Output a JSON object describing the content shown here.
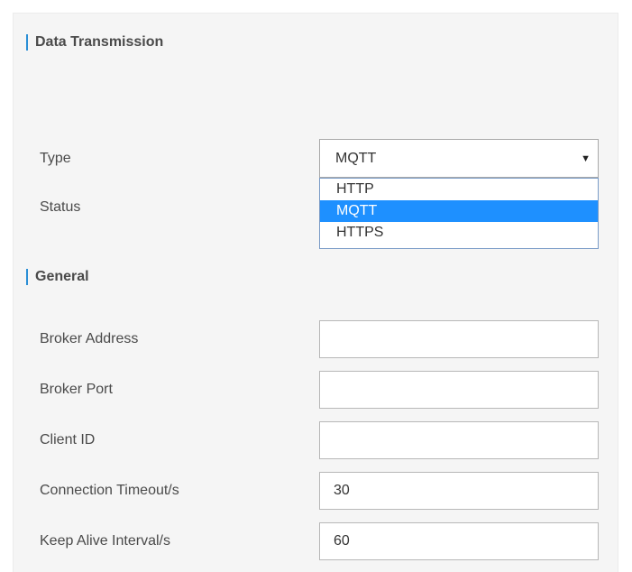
{
  "sections": {
    "data_transmission": "Data Transmission",
    "general": "General"
  },
  "type_field": {
    "label": "Type",
    "selected": "MQTT",
    "arrow_icon": "triangle-down-icon",
    "options": [
      "HTTP",
      "MQTT",
      "HTTPS"
    ],
    "highlighted_index": 1
  },
  "status_field": {
    "label": "Status"
  },
  "fields": {
    "broker_address": {
      "label": "Broker Address",
      "value": ""
    },
    "broker_port": {
      "label": "Broker Port",
      "value": ""
    },
    "client_id": {
      "label": "Client ID",
      "value": ""
    },
    "connection_timeout": {
      "label": "Connection Timeout/s",
      "value": "30"
    },
    "keep_alive_interval": {
      "label": "Keep Alive Interval/s",
      "value": "60"
    }
  },
  "colors": {
    "accent": "#2b8fd6",
    "selected_option": "#1e90ff",
    "panel_background": "#f5f5f5"
  }
}
